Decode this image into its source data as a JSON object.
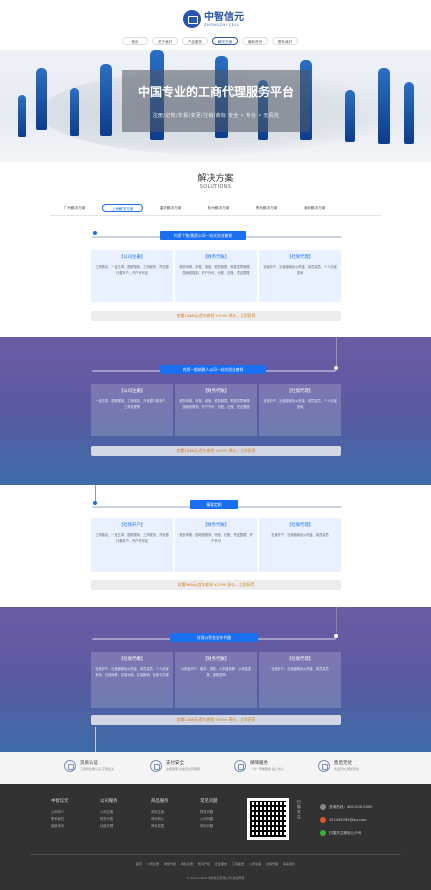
{
  "header": {
    "logo_cn": "中智信元",
    "logo_en": "ZHONGZHI CELL",
    "nav": [
      "首页",
      "关于我们",
      "产品服务",
      "解决方案",
      "最新资讯",
      "联系我们"
    ],
    "nav_active": 3
  },
  "hero": {
    "title": "中国专业的工商代理服务平台",
    "subtitle": "注册/记账/年报/变更/注销/商标   安全  •  专业  •  无风险"
  },
  "solutions": {
    "title": "解决方案",
    "subtitle": "SOLUTIONS",
    "tabs": [
      "广州解决方案",
      "上海解决方案",
      "重庆解决方案",
      "杭州解决方案",
      "青岛解决方案",
      "深圳解决方案"
    ],
    "tab_active": 1
  },
  "sections": [
    {
      "banner": "内资个独/独资公司一站式创业套餐",
      "cards": [
        {
          "title": "【公司注册】",
          "body": "工商核名、一证五章、国税报到、工商税务、开设银行基本户、开户许可证"
        },
        {
          "title": "【财务代账】",
          "body": "税务申报、年报、增值、税务报表、购进发票管理、国地税报到、开户许可、代账、记账、凭证整理"
        },
        {
          "title": "【社保代理】",
          "body": "社保开户、社保缴纳及公积金、增员减员、个人社保查询"
        }
      ],
      "pill_pre": "仅需1288元",
      "pill_post": "/首年套餐 ¥3999 原价，立即获得"
    },
    {
      "banner": "内资一般纳税人公司一站式创业套餐",
      "cards": [
        {
          "title": "【公司注册】",
          "body": "一证五章、国税报到、工商税务、开设银行基本户、工商变更等"
        },
        {
          "title": "【财务代账】",
          "body": "税务申报、年报、增值、税务报表、购进发票管理、国地税报到、开户许可、代账、记账、凭证整理"
        },
        {
          "title": "【社保代理】",
          "body": "社保开户、社保缴纳及公积金、增员减员、个人社保查询"
        }
      ],
      "pill_pre": "仅需1288元",
      "pill_post": "/首年套餐 ¥4999 原价，立即获得"
    },
    {
      "banner": "精准定制",
      "cards": [
        {
          "title": "【社保开户】",
          "body": "工商核名、一证五章、国税报到、工商税务、开设银行基本户、开户许可证"
        },
        {
          "title": "【财务代账】",
          "body": "税务申报、国地税报到、代账、记账、凭证整理、开户许可"
        },
        {
          "title": "【社保代理】",
          "body": "社保开户、社保缴纳及公积金、增员减员"
        }
      ],
      "pill_pre": "仅需988元",
      "pill_post": "/首年套餐 ¥2999 原价，立即获得"
    },
    {
      "banner": "社保公积金全年代缴",
      "cards": [
        {
          "title": "【社保代缴】",
          "body": "社保开户、社保缴纳及公积金、增员减员、个人社保查询、社保转移、社保补缴、社保报销、社保卡办理"
        },
        {
          "title": "【财务代账】",
          "body": "公积金开户、缴存、提取、公积金转移、公积金变更、提取咨询"
        },
        {
          "title": "【社保代理】",
          "body": "社保开户、社保缴纳及公积金、增员减员"
        }
      ],
      "pill_pre": "仅需1288元",
      "pill_post": "/首年套餐 ¥3999 原价，立即获得"
    }
  ],
  "features": [
    {
      "title": "资质认证",
      "sub": "工商局注册认证 正规企业"
    },
    {
      "title": "支付安全",
      "sub": "全程透明 资金安全有保障"
    },
    {
      "title": "保障服务",
      "sub": "一对一专属服务 贴心省心"
    },
    {
      "title": "售后无忧",
      "sub": "售后无忧 服务到位"
    }
  ],
  "footer": {
    "columns": [
      {
        "title": "中智信元",
        "items": [
          "公司简介",
          "联系我们",
          "最新资讯"
        ]
      },
      {
        "title": "公司服务",
        "items": [
          "公司注册",
          "财务代账",
          "社保代理"
        ]
      },
      {
        "title": "商品服务",
        "items": [
          "商标注册",
          "商标转让",
          "商标变更"
        ]
      },
      {
        "title": "常见问题",
        "items": [
          "财务问题",
          "公司问题",
          "商标问题"
        ]
      }
    ],
    "qr_caption": "扫描关注",
    "phone": "咨询热线：400-000-0000",
    "email": "321456789@qq.com",
    "wechat": "扫描关注微信公众号",
    "nav": [
      "首页",
      "公司注册",
      "财务代账",
      "商标注册",
      "知识产权",
      "企业服务",
      "工商变更",
      "公司注销",
      "社保代理",
      "联系我们"
    ],
    "copyright": "© 2017-2018 中智信元有限公司 版权所有"
  },
  "colors": {
    "brand": "#2a56a8",
    "accent": "#1a6ef0",
    "price": "#d86e14",
    "footer_bg": "#323232"
  }
}
